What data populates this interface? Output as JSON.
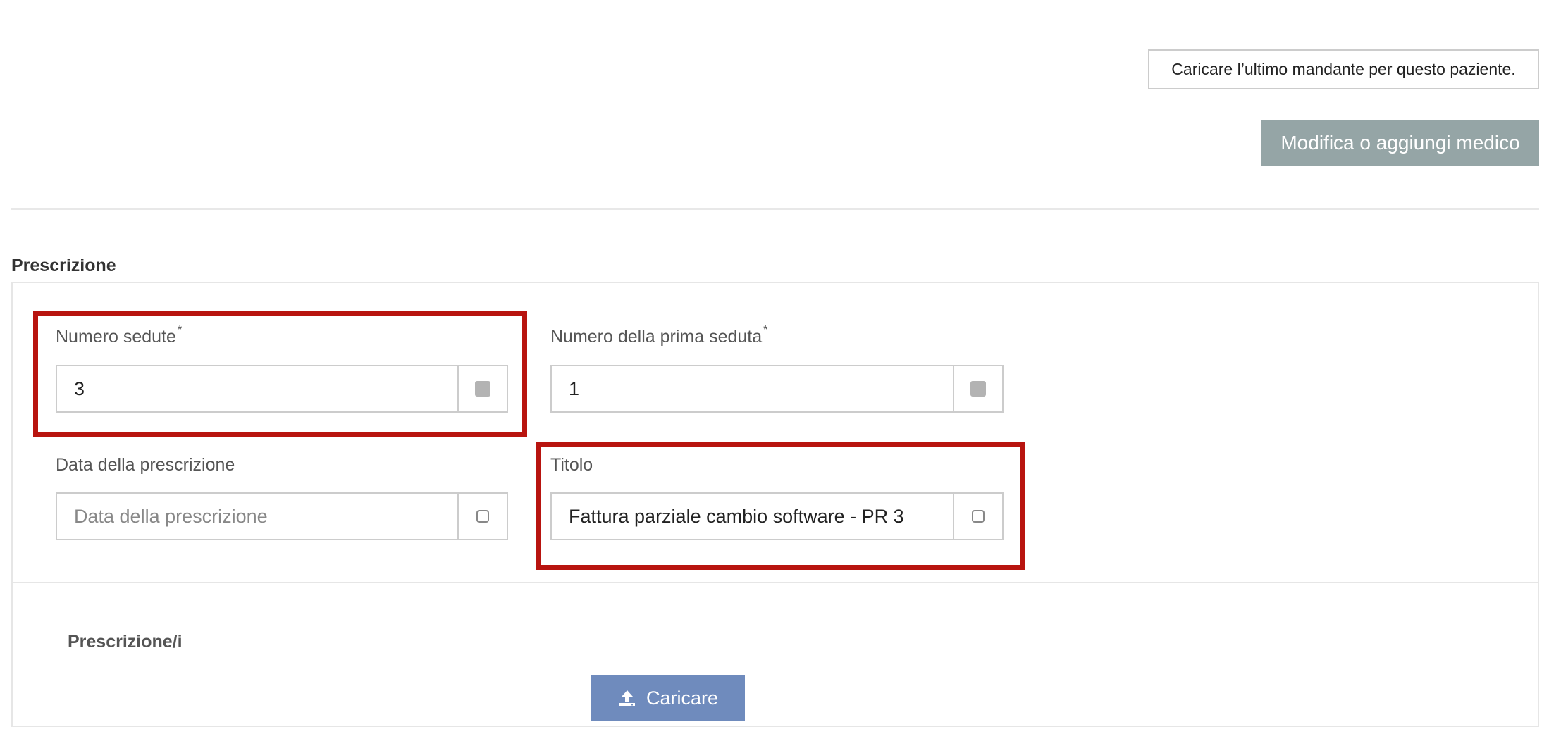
{
  "header": {
    "load_last_mandante_label": "Caricare l’ultimo mandante per questo paziente.",
    "edit_doctor_label": "Modifica o aggiungi medico"
  },
  "prescription": {
    "section_title": "Prescrizione",
    "fields": {
      "numero_sedute": {
        "label": "Numero sedute",
        "required_mark": "*",
        "value": "3"
      },
      "numero_prima_seduta": {
        "label": "Numero della prima seduta",
        "required_mark": "*",
        "value": "1"
      },
      "data_prescrizione": {
        "label": "Data della prescrizione",
        "value": "",
        "placeholder": "Data della prescrizione"
      },
      "titolo": {
        "label": "Titolo",
        "value": "Fattura parziale cambio software - PR 3"
      }
    },
    "attachments": {
      "title": "Prescrizione/i",
      "upload_label": "Caricare"
    }
  },
  "colors": {
    "highlight": "#b8140f",
    "edit_doctor_bg": "#95a5a6",
    "upload_bg": "#6f8bbd"
  },
  "icons": {
    "numeric_addon": "square-filled-icon",
    "text_addon": "square-outline-icon",
    "upload": "upload-icon"
  }
}
